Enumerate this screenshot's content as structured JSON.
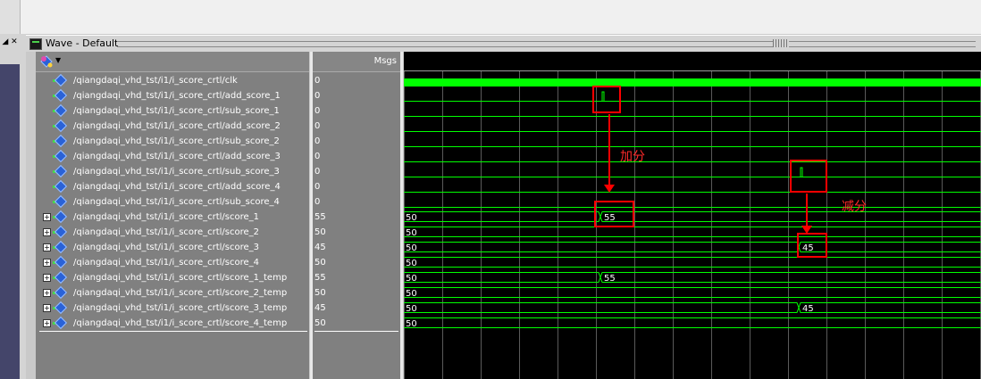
{
  "window": {
    "title": "Wave - Default"
  },
  "panel": {
    "value_header": "Msgs",
    "left_controls": "◢ ✕"
  },
  "signals": [
    {
      "name": "/qiangdaqi_vhd_tst/i1/i_score_crtl/clk",
      "value": "0",
      "bus": false
    },
    {
      "name": "/qiangdaqi_vhd_tst/i1/i_score_crtl/add_score_1",
      "value": "0",
      "bus": false
    },
    {
      "name": "/qiangdaqi_vhd_tst/i1/i_score_crtl/sub_score_1",
      "value": "0",
      "bus": false
    },
    {
      "name": "/qiangdaqi_vhd_tst/i1/i_score_crtl/add_score_2",
      "value": "0",
      "bus": false
    },
    {
      "name": "/qiangdaqi_vhd_tst/i1/i_score_crtl/sub_score_2",
      "value": "0",
      "bus": false
    },
    {
      "name": "/qiangdaqi_vhd_tst/i1/i_score_crtl/add_score_3",
      "value": "0",
      "bus": false
    },
    {
      "name": "/qiangdaqi_vhd_tst/i1/i_score_crtl/sub_score_3",
      "value": "0",
      "bus": false
    },
    {
      "name": "/qiangdaqi_vhd_tst/i1/i_score_crtl/add_score_4",
      "value": "0",
      "bus": false
    },
    {
      "name": "/qiangdaqi_vhd_tst/i1/i_score_crtl/sub_score_4",
      "value": "0",
      "bus": false
    },
    {
      "name": "/qiangdaqi_vhd_tst/i1/i_score_crtl/score_1",
      "value": "55",
      "bus": true
    },
    {
      "name": "/qiangdaqi_vhd_tst/i1/i_score_crtl/score_2",
      "value": "50",
      "bus": true
    },
    {
      "name": "/qiangdaqi_vhd_tst/i1/i_score_crtl/score_3",
      "value": "45",
      "bus": true
    },
    {
      "name": "/qiangdaqi_vhd_tst/i1/i_score_crtl/score_4",
      "value": "50",
      "bus": true
    },
    {
      "name": "/qiangdaqi_vhd_tst/i1/i_score_crtl/score_1_temp",
      "value": "55",
      "bus": true
    },
    {
      "name": "/qiangdaqi_vhd_tst/i1/i_score_crtl/score_2_temp",
      "value": "50",
      "bus": true
    },
    {
      "name": "/qiangdaqi_vhd_tst/i1/i_score_crtl/score_3_temp",
      "value": "45",
      "bus": true
    },
    {
      "name": "/qiangdaqi_vhd_tst/i1/i_score_crtl/score_4_temp",
      "value": "50",
      "bus": true
    }
  ],
  "waves": {
    "bus_labels": [
      {
        "row": 9,
        "segments": [
          "50",
          "55"
        ]
      },
      {
        "row": 10,
        "segments": [
          "50"
        ]
      },
      {
        "row": 11,
        "segments": [
          "50",
          "45"
        ]
      },
      {
        "row": 12,
        "segments": [
          "50"
        ]
      },
      {
        "row": 13,
        "segments": [
          "50",
          "55"
        ]
      },
      {
        "row": 14,
        "segments": [
          "50"
        ]
      },
      {
        "row": 15,
        "segments": [
          "50",
          "45"
        ]
      },
      {
        "row": 16,
        "segments": [
          "50"
        ]
      }
    ]
  },
  "annotations": {
    "add": "加分",
    "sub": "减分"
  },
  "colors": {
    "wave": "#00ff00",
    "clock": "#00ff00",
    "annotation": "#ff0000",
    "background": "#000000"
  }
}
